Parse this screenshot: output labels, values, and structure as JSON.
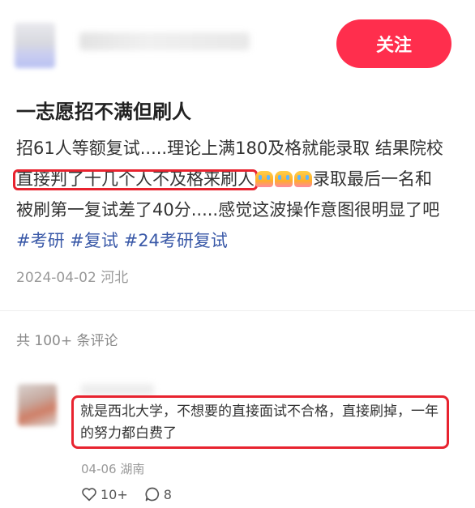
{
  "header": {
    "follow_label": "关注"
  },
  "post": {
    "title": "一志愿招不满但刷人",
    "body_part1": "招61人等额复试.....理论上满180及格就能录取 结果院校",
    "body_highlight": "直接判了十几个人不及格来刷人",
    "emojis": [
      "crying-emoji",
      "crying-emoji",
      "crying-emoji"
    ],
    "body_part2": "录取最后一名和被刷第一复试差了40分.....感觉这波操作意图很明显了吧",
    "tags": [
      "#考研",
      "#复试",
      "#24考研复试"
    ],
    "date": "2024-04-02",
    "location": "河北"
  },
  "comments_header": {
    "count_text": "共 100+ 条评论"
  },
  "comment": {
    "text": "就是西北大学，不想要的直接面试不合格，直接刷掉，一年的努力都白费了",
    "date": "04-06",
    "location": "湖南",
    "likes": "10+",
    "replies": "8"
  },
  "colors": {
    "accent": "#ff2e4d",
    "highlight_border": "#e8232f",
    "tag": "#3a59a8"
  }
}
